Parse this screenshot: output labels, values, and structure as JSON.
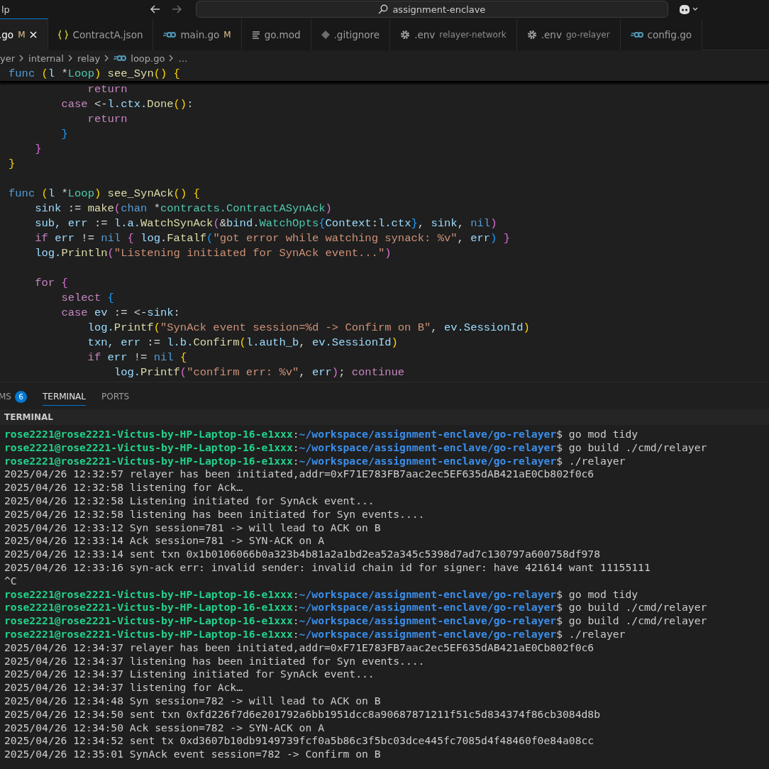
{
  "title_bar": {
    "menu_label": "lp",
    "search": "assignment-enclave"
  },
  "tabs": [
    {
      "label": ".go",
      "badge": "M",
      "selected": true
    },
    {
      "label": "ContractA.json",
      "kind": "json",
      "selected": false
    },
    {
      "label": "main.go",
      "badge": "M",
      "kind": "go",
      "selected": false
    },
    {
      "label": "go.mod",
      "kind": "mod",
      "selected": false
    },
    {
      "label": ".gitignore",
      "kind": "git",
      "selected": false
    },
    {
      "label": ".env",
      "description": "relayer-network",
      "kind": "env",
      "selected": false
    },
    {
      "label": ".env",
      "description": "go-relayer",
      "kind": "env",
      "selected": false
    },
    {
      "label": "config.go",
      "kind": "go",
      "selected": false
    }
  ],
  "breadcrumb": [
    {
      "label": "yer",
      "kind": "folder"
    },
    {
      "label": "internal",
      "kind": "folder"
    },
    {
      "label": "relay",
      "kind": "folder"
    },
    {
      "label": "loop.go",
      "kind": "go"
    },
    {
      "label": "…",
      "kind": "folder"
    }
  ],
  "sticky_line": [
    {
      "kind": "kw",
      "text": "func "
    },
    {
      "kind": "br1",
      "text": "("
    },
    {
      "kind": "var",
      "text": "l "
    },
    {
      "kind": "plain",
      "text": "*"
    },
    {
      "kind": "type",
      "text": "Loop"
    },
    {
      "kind": "br1",
      "text": ")"
    },
    {
      "kind": "fn",
      "text": " see_Syn"
    },
    {
      "kind": "br1",
      "text": "()"
    },
    {
      "kind": "br1",
      "text": " {"
    }
  ],
  "code_lines": [
    {
      "kind": "code",
      "tokens": [
        {
          "kind": "ctl",
          "text": "            return"
        }
      ]
    },
    {
      "kind": "code",
      "tokens": [
        {
          "kind": "ctl",
          "text": "        case "
        },
        {
          "kind": "plain",
          "text": "<-"
        },
        {
          "kind": "var",
          "text": "l.ctx."
        },
        {
          "kind": "fn",
          "text": "Done"
        },
        {
          "kind": "br1",
          "text": "()"
        },
        {
          "kind": "plain",
          "text": ":"
        }
      ]
    },
    {
      "kind": "code",
      "tokens": [
        {
          "kind": "ctl",
          "text": "            return"
        }
      ]
    },
    {
      "kind": "code",
      "tokens": [
        {
          "kind": "br3",
          "text": "        }"
        }
      ]
    },
    {
      "kind": "code",
      "tokens": [
        {
          "kind": "br2",
          "text": "    }"
        }
      ]
    },
    {
      "kind": "code",
      "tokens": [
        {
          "kind": "br1",
          "text": "}"
        }
      ]
    },
    {
      "kind": "blank"
    },
    {
      "kind": "code",
      "tokens": [
        {
          "kind": "kw",
          "text": "func "
        },
        {
          "kind": "br1",
          "text": "("
        },
        {
          "kind": "var",
          "text": "l "
        },
        {
          "kind": "plain",
          "text": "*"
        },
        {
          "kind": "type",
          "text": "Loop"
        },
        {
          "kind": "br1",
          "text": ")"
        },
        {
          "kind": "fn",
          "text": " see_SynAck"
        },
        {
          "kind": "br1",
          "text": "()"
        },
        {
          "kind": "br1",
          "text": " {"
        }
      ]
    },
    {
      "kind": "code",
      "tokens": [
        {
          "kind": "var",
          "text": "    sink "
        },
        {
          "kind": "plain",
          "text": ":= "
        },
        {
          "kind": "fn",
          "text": "make"
        },
        {
          "kind": "br2",
          "text": "("
        },
        {
          "kind": "kw",
          "text": "chan "
        },
        {
          "kind": "plain",
          "text": "*"
        },
        {
          "kind": "type",
          "text": "contracts.ContractASynAck"
        },
        {
          "kind": "br2",
          "text": ")"
        }
      ]
    },
    {
      "kind": "code",
      "tokens": [
        {
          "kind": "var",
          "text": "    sub, err "
        },
        {
          "kind": "plain",
          "text": ":= "
        },
        {
          "kind": "var",
          "text": "l.a."
        },
        {
          "kind": "fn",
          "text": "WatchSynAck"
        },
        {
          "kind": "br2",
          "text": "("
        },
        {
          "kind": "plain",
          "text": "&"
        },
        {
          "kind": "var",
          "text": "bind."
        },
        {
          "kind": "type",
          "text": "WatchOpts"
        },
        {
          "kind": "br3",
          "text": "{"
        },
        {
          "kind": "var",
          "text": "Context"
        },
        {
          "kind": "plain",
          "text": ":"
        },
        {
          "kind": "var",
          "text": "l.ctx"
        },
        {
          "kind": "br3",
          "text": "}"
        },
        {
          "kind": "plain",
          "text": ", "
        },
        {
          "kind": "var",
          "text": "sink"
        },
        {
          "kind": "plain",
          "text": ", "
        },
        {
          "kind": "kw",
          "text": "nil"
        },
        {
          "kind": "br2",
          "text": ")"
        }
      ]
    },
    {
      "kind": "code",
      "tokens": [
        {
          "kind": "ctl",
          "text": "    if "
        },
        {
          "kind": "var",
          "text": "err "
        },
        {
          "kind": "plain",
          "text": "!= "
        },
        {
          "kind": "kw",
          "text": "nil "
        },
        {
          "kind": "br2",
          "text": "{ "
        },
        {
          "kind": "var",
          "text": "log."
        },
        {
          "kind": "fn",
          "text": "Fatalf"
        },
        {
          "kind": "br3",
          "text": "("
        },
        {
          "kind": "str",
          "text": "\"got error while watching synack: %v\""
        },
        {
          "kind": "plain",
          "text": ", "
        },
        {
          "kind": "var",
          "text": "err"
        },
        {
          "kind": "br3",
          "text": ")"
        },
        {
          "kind": "br2",
          "text": " }"
        }
      ]
    },
    {
      "kind": "code",
      "tokens": [
        {
          "kind": "var",
          "text": "    log."
        },
        {
          "kind": "fn",
          "text": "Println"
        },
        {
          "kind": "br2",
          "text": "("
        },
        {
          "kind": "str",
          "text": "\"Listening initiated for SynAck event...\""
        },
        {
          "kind": "br2",
          "text": ")"
        }
      ]
    },
    {
      "kind": "blank"
    },
    {
      "kind": "code",
      "tokens": [
        {
          "kind": "ctl",
          "text": "    for "
        },
        {
          "kind": "br2",
          "text": "{"
        }
      ]
    },
    {
      "kind": "code",
      "tokens": [
        {
          "kind": "ctl",
          "text": "        select "
        },
        {
          "kind": "br3",
          "text": "{"
        }
      ]
    },
    {
      "kind": "code",
      "tokens": [
        {
          "kind": "ctl",
          "text": "        case "
        },
        {
          "kind": "var",
          "text": "ev "
        },
        {
          "kind": "plain",
          "text": ":= <-"
        },
        {
          "kind": "var",
          "text": "sink"
        },
        {
          "kind": "plain",
          "text": ":"
        }
      ]
    },
    {
      "kind": "code",
      "tokens": [
        {
          "kind": "var",
          "text": "            log."
        },
        {
          "kind": "fn",
          "text": "Printf"
        },
        {
          "kind": "br1",
          "text": "("
        },
        {
          "kind": "str",
          "text": "\"SynAck event session=%d -> Confirm on B\""
        },
        {
          "kind": "plain",
          "text": ", "
        },
        {
          "kind": "var",
          "text": "ev.SessionId"
        },
        {
          "kind": "br1",
          "text": ")"
        }
      ]
    },
    {
      "kind": "code",
      "tokens": [
        {
          "kind": "var",
          "text": "            txn, err "
        },
        {
          "kind": "plain",
          "text": ":= "
        },
        {
          "kind": "var",
          "text": "l.b."
        },
        {
          "kind": "fn",
          "text": "Confirm"
        },
        {
          "kind": "br1",
          "text": "("
        },
        {
          "kind": "var",
          "text": "l.auth_b"
        },
        {
          "kind": "plain",
          "text": ", "
        },
        {
          "kind": "var",
          "text": "ev.SessionId"
        },
        {
          "kind": "br1",
          "text": ")"
        }
      ]
    },
    {
      "kind": "code",
      "tokens": [
        {
          "kind": "ctl",
          "text": "            if "
        },
        {
          "kind": "var",
          "text": "err "
        },
        {
          "kind": "plain",
          "text": "!= "
        },
        {
          "kind": "kw",
          "text": "nil "
        },
        {
          "kind": "br1",
          "text": "{"
        }
      ]
    },
    {
      "kind": "code",
      "tokens": [
        {
          "kind": "var",
          "text": "                log."
        },
        {
          "kind": "fn",
          "text": "Printf"
        },
        {
          "kind": "br2",
          "text": "("
        },
        {
          "kind": "str",
          "text": "\"confirm err: %v\""
        },
        {
          "kind": "plain",
          "text": ", "
        },
        {
          "kind": "var",
          "text": "err"
        },
        {
          "kind": "br2",
          "text": ")"
        },
        {
          "kind": "plain",
          "text": "; "
        },
        {
          "kind": "ctl",
          "text": "continue"
        }
      ]
    }
  ],
  "panel_tabs": [
    {
      "label": "MS",
      "count": "6",
      "selected": false
    },
    {
      "label": "TERMINAL",
      "selected": true
    },
    {
      "label": "PORTS",
      "selected": false
    }
  ],
  "terminal": {
    "header": "TERMINAL",
    "lines": [
      [
        {
          "kind": "user",
          "text": "rose2221@rose2221-Victus-by-HP-Laptop-16-e1xxx"
        },
        {
          "kind": "plain",
          "text": ":"
        },
        {
          "kind": "path",
          "text": "~/workspace/assignment-enclave/go-relayer"
        },
        {
          "kind": "plain",
          "text": "$ go mod tidy"
        }
      ],
      [
        {
          "kind": "user",
          "text": "rose2221@rose2221-Victus-by-HP-Laptop-16-e1xxx"
        },
        {
          "kind": "plain",
          "text": ":"
        },
        {
          "kind": "path",
          "text": "~/workspace/assignment-enclave/go-relayer"
        },
        {
          "kind": "plain",
          "text": "$ go build ./cmd/relayer"
        }
      ],
      [
        {
          "kind": "user",
          "text": "rose2221@rose2221-Victus-by-HP-Laptop-16-e1xxx"
        },
        {
          "kind": "plain",
          "text": ":"
        },
        {
          "kind": "path",
          "text": "~/workspace/assignment-enclave/go-relayer"
        },
        {
          "kind": "plain",
          "text": "$ ./relayer"
        }
      ],
      [
        {
          "kind": "plain",
          "text": "2025/04/26 12:32:57 relayer has been initiated,addr=0xF71E783FB7aac2ec5EF635dAB421aE0Cb802f0c6"
        }
      ],
      [
        {
          "kind": "plain",
          "text": "2025/04/26 12:32:58 listening for Ack…"
        }
      ],
      [
        {
          "kind": "plain",
          "text": "2025/04/26 12:32:58 Listening initiated for SynAck event..."
        }
      ],
      [
        {
          "kind": "plain",
          "text": "2025/04/26 12:32:58 listening has been initiated for Syn events...."
        }
      ],
      [
        {
          "kind": "plain",
          "text": "2025/04/26 12:33:12 Syn session=781 -> will lead to ACK on B"
        }
      ],
      [
        {
          "kind": "plain",
          "text": "2025/04/26 12:33:14 Ack session=781 -> SYN-ACK on A"
        }
      ],
      [
        {
          "kind": "plain",
          "text": "2025/04/26 12:33:14 sent txn 0x1b0106066b0a323b4b81a2a1bd2ea52a345c5398d7ad7c130797a600758df978"
        }
      ],
      [
        {
          "kind": "plain",
          "text": "2025/04/26 12:33:16 syn-ack err: invalid sender: invalid chain id for signer: have 421614 want 11155111"
        }
      ],
      [
        {
          "kind": "plain",
          "text": "^C"
        }
      ],
      [
        {
          "kind": "user",
          "text": "rose2221@rose2221-Victus-by-HP-Laptop-16-e1xxx"
        },
        {
          "kind": "plain",
          "text": ":"
        },
        {
          "kind": "path",
          "text": "~/workspace/assignment-enclave/go-relayer"
        },
        {
          "kind": "plain",
          "text": "$ go mod tidy"
        }
      ],
      [
        {
          "kind": "user",
          "text": "rose2221@rose2221-Victus-by-HP-Laptop-16-e1xxx"
        },
        {
          "kind": "plain",
          "text": ":"
        },
        {
          "kind": "path",
          "text": "~/workspace/assignment-enclave/go-relayer"
        },
        {
          "kind": "plain",
          "text": "$ go build ./cmd/relayer"
        }
      ],
      [
        {
          "kind": "user",
          "text": "rose2221@rose2221-Victus-by-HP-Laptop-16-e1xxx"
        },
        {
          "kind": "plain",
          "text": ":"
        },
        {
          "kind": "path",
          "text": "~/workspace/assignment-enclave/go-relayer"
        },
        {
          "kind": "plain",
          "text": "$ go build ./cmd/relayer"
        }
      ],
      [
        {
          "kind": "user",
          "text": "rose2221@rose2221-Victus-by-HP-Laptop-16-e1xxx"
        },
        {
          "kind": "plain",
          "text": ":"
        },
        {
          "kind": "path",
          "text": "~/workspace/assignment-enclave/go-relayer"
        },
        {
          "kind": "plain",
          "text": "$ ./relayer"
        }
      ],
      [
        {
          "kind": "plain",
          "text": "2025/04/26 12:34:37 relayer has been initiated,addr=0xF71E783FB7aac2ec5EF635dAB421aE0Cb802f0c6"
        }
      ],
      [
        {
          "kind": "plain",
          "text": "2025/04/26 12:34:37 listening has been initiated for Syn events...."
        }
      ],
      [
        {
          "kind": "plain",
          "text": "2025/04/26 12:34:37 Listening initiated for SynAck event..."
        }
      ],
      [
        {
          "kind": "plain",
          "text": "2025/04/26 12:34:37 listening for Ack…"
        }
      ],
      [
        {
          "kind": "plain",
          "text": "2025/04/26 12:34:48 Syn session=782 -> will lead to ACK on B"
        }
      ],
      [
        {
          "kind": "plain",
          "text": "2025/04/26 12:34:50 sent txn 0xfd226f7d6e201792a6bb1951dcc8a90687871211f51c5d834374f86cb3084d8b"
        }
      ],
      [
        {
          "kind": "plain",
          "text": "2025/04/26 12:34:50 Ack session=782 -> SYN-ACK on A"
        }
      ],
      [
        {
          "kind": "plain",
          "text": "2025/04/26 12:34:52 sent tx 0xd3607b10db9149739fcf0a5b86c3f5bc03dce445fc7085d4f48460f0e84a08cc"
        }
      ],
      [
        {
          "kind": "plain",
          "text": "2025/04/26 12:35:01 SynAck event session=782 -> Confirm on B"
        }
      ]
    ]
  }
}
